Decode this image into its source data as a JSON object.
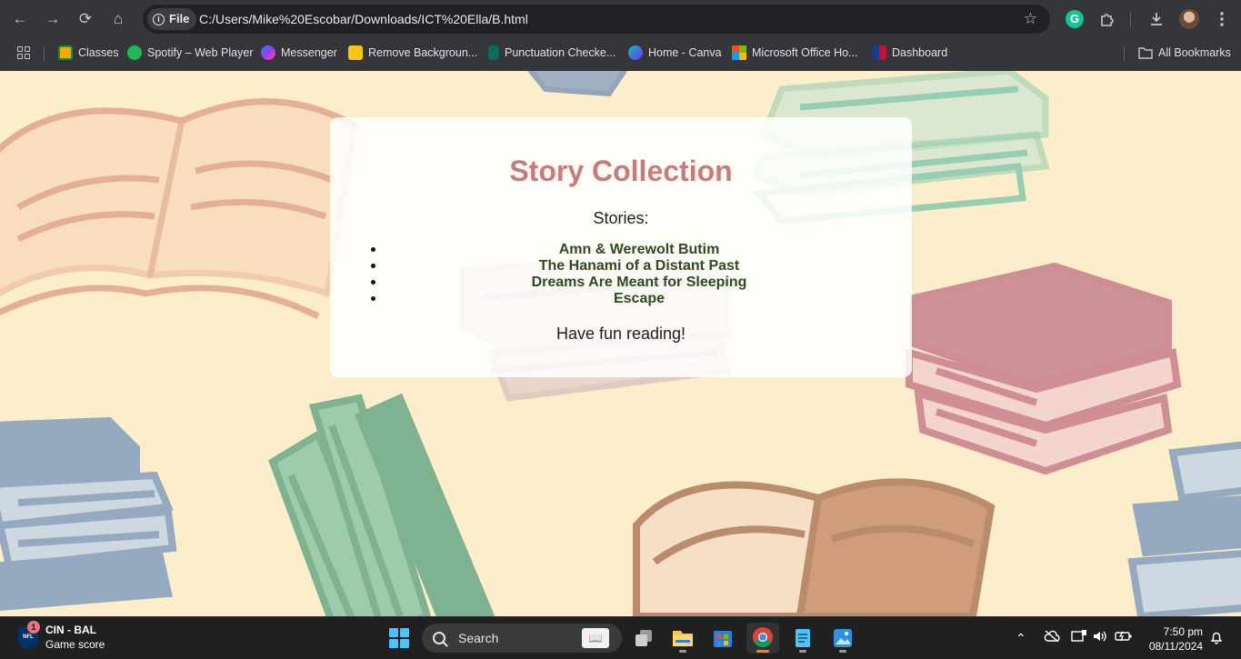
{
  "browser": {
    "nav": {
      "back": "←",
      "forward": "→",
      "reload": "⟳",
      "home": "⌂"
    },
    "address": {
      "chip_label": "File",
      "url": "C:/Users/Mike%20Escobar/Downloads/ICT%20Ella/B.html"
    },
    "extensions": {
      "grammarly": "G"
    }
  },
  "bookmarks": {
    "items": [
      {
        "label": "Classes",
        "icon": "classroom-icon",
        "color": "#f9ab00"
      },
      {
        "label": "Spotify – Web Player",
        "icon": "spotify-icon",
        "color": "#1db954"
      },
      {
        "label": "Messenger",
        "icon": "messenger-icon",
        "color": "#a334fa"
      },
      {
        "label": "Remove Backgroun...",
        "icon": "remove-bg-icon",
        "color": "#f5c518"
      },
      {
        "label": "Punctuation Checke...",
        "icon": "punctuation-icon",
        "color": "#0b6b5a"
      },
      {
        "label": "Home - Canva",
        "icon": "canva-icon",
        "color": "#7d2ae8"
      },
      {
        "label": "Microsoft Office Ho...",
        "icon": "microsoft-icon",
        "color": "#f25022"
      },
      {
        "label": "Dashboard",
        "icon": "dashboard-icon",
        "color": "#c41230"
      }
    ],
    "all_bookmarks": "All Bookmarks"
  },
  "page": {
    "title": "Story Collection",
    "subtitle": "Stories:",
    "stories": [
      "Amn & Werewolt Butim",
      "The Hanami of a Distant Past",
      "Dreams Are Meant for Sleeping",
      "Escape"
    ],
    "footer": "Have fun reading!",
    "colors": {
      "background": "#fdeecb",
      "title": "#c97b7b",
      "story_text": "#2f4a1f"
    }
  },
  "taskbar": {
    "widget": {
      "badge": "1",
      "title": "CIN - BAL",
      "subtitle": "Game score",
      "logo": "NFL"
    },
    "search_label": "Search",
    "clock": {
      "time": "7:50 pm",
      "date": "08/11/2024"
    }
  }
}
